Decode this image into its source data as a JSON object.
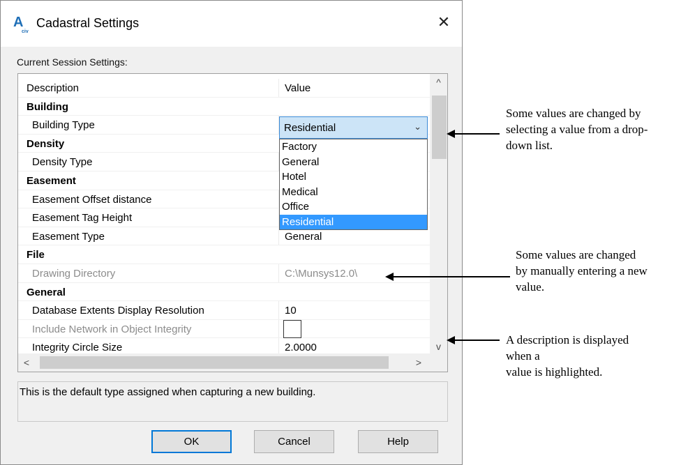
{
  "window": {
    "title": "Cadastral Settings",
    "close_glyph": "✕",
    "app_icon": "autocad-a-icon",
    "app_icon_letter": "A",
    "app_icon_sub": "civ"
  },
  "section_label": "Current Session Settings:",
  "grid": {
    "header": {
      "description": "Description",
      "value": "Value"
    },
    "rows": [
      {
        "type": "category",
        "description": "Building"
      },
      {
        "type": "prop",
        "description": "Building Type",
        "value": "Residential"
      },
      {
        "type": "category",
        "description": "Density"
      },
      {
        "type": "prop",
        "description": "Density Type",
        "value": ""
      },
      {
        "type": "category",
        "description": "Easement"
      },
      {
        "type": "prop",
        "description": "Easement Offset distance",
        "value": ""
      },
      {
        "type": "prop",
        "description": "Easement Tag Height",
        "value": ""
      },
      {
        "type": "prop",
        "description": "Easement Type",
        "value": "General"
      },
      {
        "type": "category",
        "description": "File"
      },
      {
        "type": "disabled",
        "description": "Drawing Directory",
        "value": "C:\\Munsys12.0\\"
      },
      {
        "type": "category",
        "description": "General"
      },
      {
        "type": "prop",
        "description": "Database Extents Display Resolution",
        "value": "10"
      },
      {
        "type": "disabled",
        "description": "Include Network in Object Integrity",
        "value": ""
      },
      {
        "type": "prop",
        "description": "Integrity Circle Size",
        "value": "2.0000"
      }
    ]
  },
  "combo": {
    "selected": "Residential",
    "options": [
      "Factory",
      "General",
      "Hotel",
      "Medical",
      "Office",
      "Residential"
    ],
    "highlighted_index": 5
  },
  "description_text": "This is the default type assigned when capturing a new building.",
  "buttons": {
    "ok": "OK",
    "cancel": "Cancel",
    "help": "Help"
  },
  "scroll": {
    "up": "^",
    "down": "v",
    "left": "<",
    "right": ">"
  },
  "annotations": {
    "dropdown": [
      "Some values are changed by",
      "selecting a value from a drop-",
      "down list."
    ],
    "manual": [
      "Some values are changed",
      "by manually entering a new",
      "value."
    ],
    "description": [
      "A description is displayed",
      "when a",
      "value is highlighted."
    ]
  },
  "colors": {
    "selection": "#3399ff",
    "combo_fill": "#cce4f7",
    "default_button_border": "#0078d7"
  }
}
